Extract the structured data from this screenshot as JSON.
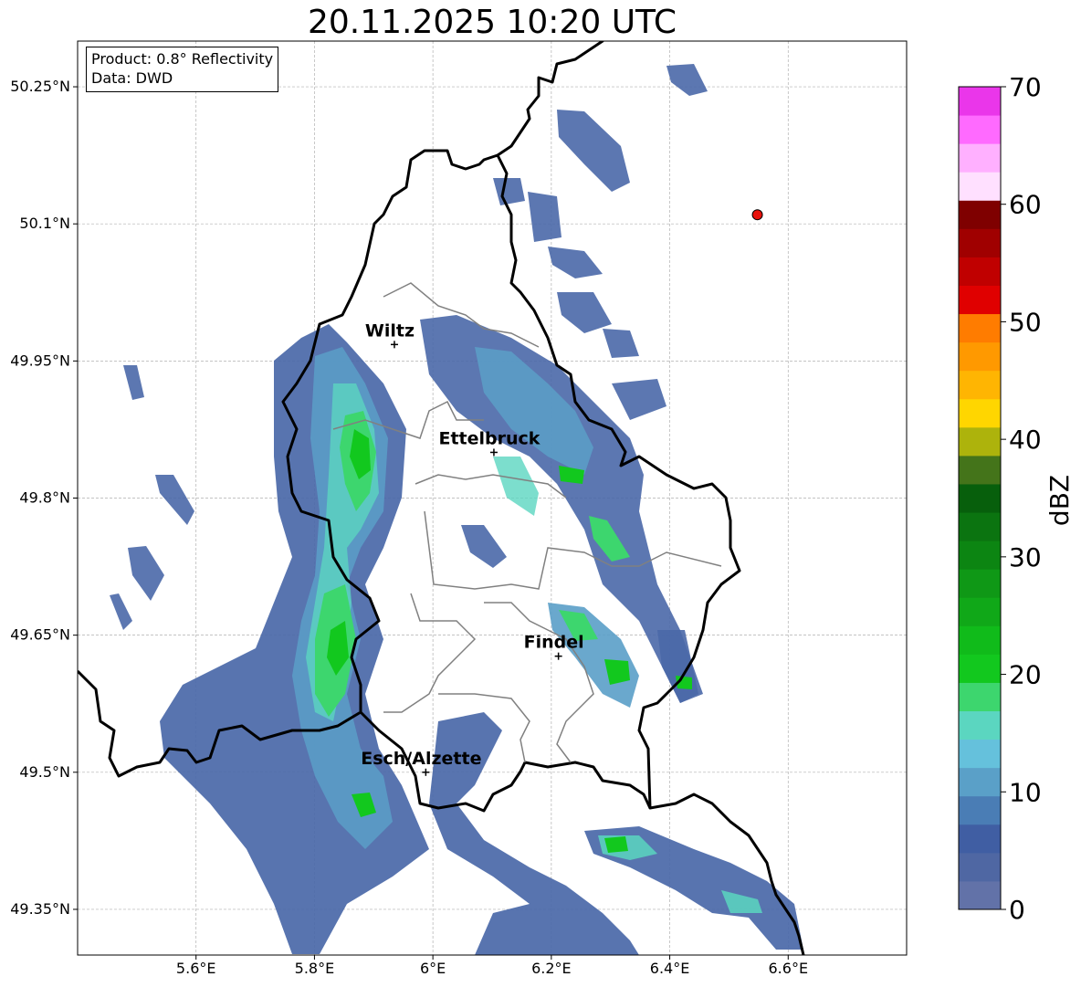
{
  "title": "20.11.2025 10:20 UTC",
  "infobox": {
    "product": "Product: 0.8° Reflectivity",
    "data": "Data: DWD"
  },
  "map": {
    "lon_range": [
      5.4,
      6.8
    ],
    "lat_range": [
      49.3,
      50.3
    ],
    "gridlines": true,
    "x_ticks": [
      {
        "lon": 5.6,
        "label": "5.6°E"
      },
      {
        "lon": 5.8,
        "label": "5.8°E"
      },
      {
        "lon": 6.0,
        "label": "6°E"
      },
      {
        "lon": 6.2,
        "label": "6.2°E"
      },
      {
        "lon": 6.4,
        "label": "6.4°E"
      },
      {
        "lon": 6.6,
        "label": "6.6°E"
      }
    ],
    "y_ticks": [
      {
        "lat": 50.25,
        "label": "50.25°N"
      },
      {
        "lat": 50.1,
        "label": "50.1°N"
      },
      {
        "lat": 49.95,
        "label": "49.95°N"
      },
      {
        "lat": 49.8,
        "label": "49.8°N"
      },
      {
        "lat": 49.65,
        "label": "49.65°N"
      },
      {
        "lat": 49.5,
        "label": "49.5°N"
      },
      {
        "lat": 49.35,
        "label": "49.35°N"
      }
    ],
    "cities": [
      {
        "name": "Wiltz",
        "lon": 5.935,
        "lat": 49.968
      },
      {
        "name": "Ettelbruck",
        "lon": 6.103,
        "lat": 49.85
      },
      {
        "name": "Findel",
        "lon": 6.212,
        "lat": 49.627
      },
      {
        "name": "Esch/Alzette",
        "lon": 5.988,
        "lat": 49.5
      }
    ],
    "radar_site": {
      "lon": 6.548,
      "lat": 50.11,
      "color": "#e8120c"
    }
  },
  "colorbar": {
    "label": "dBZ",
    "ticks": [
      0,
      10,
      20,
      30,
      40,
      50,
      60,
      70
    ],
    "range": [
      0,
      70
    ],
    "colors": [
      "#6272a8",
      "#4f67a3",
      "#405ea3",
      "#4a7db5",
      "#5aa0c8",
      "#65c1dc",
      "#5bd6c0",
      "#3dd66e",
      "#12c81e",
      "#10bb1a",
      "#10a818",
      "#0f9816",
      "#0c8512",
      "#0b7410",
      "#075f0c",
      "#44741a",
      "#adb30c",
      "#ffd600",
      "#ffb502",
      "#ff9900",
      "#ff7c00",
      "#e00000",
      "#c00000",
      "#a00000",
      "#7f0000",
      "#ffe0ff",
      "#ffb0ff",
      "#ff6aff",
      "#ea36ea"
    ]
  }
}
